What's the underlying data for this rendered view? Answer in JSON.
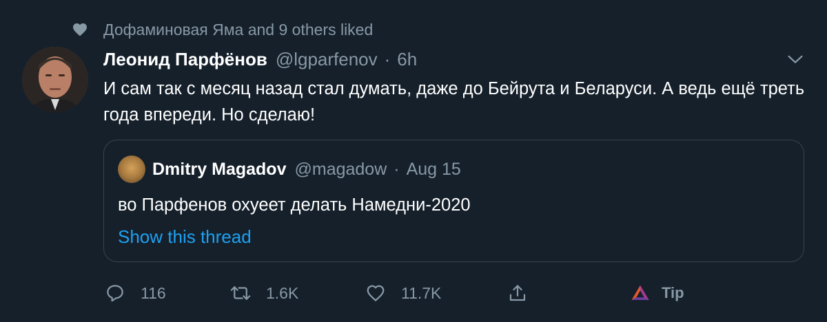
{
  "social_context": {
    "icon": "heart-filled-icon",
    "text": "Дофаминовая Яма and 9 others liked"
  },
  "tweet": {
    "name": "Леонид Парфёнов",
    "handle": "@lgparfenov",
    "separator": "·",
    "time": "6h",
    "text": "И сам так с месяц назад стал думать, даже до Бейрута и Беларуси. А ведь ещё треть года впереди. Но сделаю!"
  },
  "quote": {
    "name": "Dmitry Magadov",
    "handle": "@magadow",
    "separator": "·",
    "time": "Aug 15",
    "text": "во Парфенов охуеет делать Намедни-2020",
    "thread_link": "Show this thread"
  },
  "actions": {
    "reply_count": "116",
    "retweet_count": "1.6K",
    "like_count": "11.7K",
    "tip_label": "Tip"
  },
  "colors": {
    "background": "#15202b",
    "secondary_text": "#8899a6",
    "link": "#1da1f2",
    "border": "#38444d"
  }
}
